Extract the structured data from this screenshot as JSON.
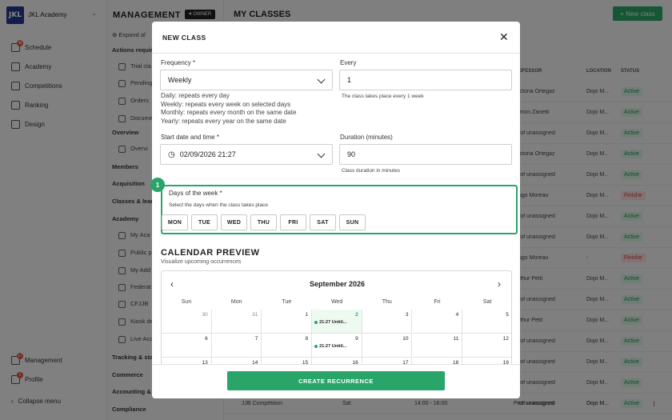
{
  "app": {
    "name": "JKL Academy",
    "logo_text": "JKL"
  },
  "sidebar": {
    "items": [
      {
        "label": "Schedule",
        "icon": "calendar-icon",
        "badge": "38"
      },
      {
        "label": "Academy",
        "icon": "academy-icon"
      },
      {
        "label": "Competitions",
        "icon": "trophy-icon"
      },
      {
        "label": "Ranking",
        "icon": "ranking-icon"
      },
      {
        "label": "Design",
        "icon": "design-icon"
      }
    ],
    "bottom": [
      {
        "label": "Management",
        "icon": "management-icon",
        "badge": "17"
      },
      {
        "label": "Profile",
        "icon": "profile-icon",
        "badge": "1"
      }
    ],
    "collapse": "Collapse menu"
  },
  "subnav": {
    "expand": "Expand al",
    "items": [
      "Actions requir",
      "Trial cla",
      "Pending",
      "Orders",
      "Docume",
      "Overview",
      "Overvi",
      "Members",
      "Acquisition",
      "Classes & lean",
      "Academy",
      "My Aca",
      "Public p",
      "My Add",
      "Federat",
      "CFJJB",
      "Kiosk de",
      "Live Acc",
      "Tracking & sta",
      "Commerce",
      "Accounting &",
      "Compliance"
    ]
  },
  "header": {
    "section": "MANAGEMENT",
    "owner_badge": "OWNER",
    "page_title": "MY CLASSES",
    "new_class": "+ New class"
  },
  "table": {
    "headers": [
      "OFESSOR",
      "LOCATION",
      "STATUS"
    ],
    "rows": [
      {
        "professor": "ictoria Ortegaz",
        "location": "Dojo M...",
        "status": "Active"
      },
      {
        "professor": "imon Zanetti",
        "location": "Dojo M...",
        "status": "Active"
      },
      {
        "professor": "rof unassigned",
        "location": "Dojo M...",
        "status": "Active"
      },
      {
        "professor": "ictoria Ortegaz",
        "location": "Dojo M...",
        "status": "Active"
      },
      {
        "professor": "rof unassigned",
        "location": "Dojo M...",
        "status": "Active"
      },
      {
        "professor": "ugo Moreau",
        "location": "Dojo M...",
        "status": "Finishe"
      },
      {
        "professor": "rof unassigned",
        "location": "Dojo M...",
        "status": "Active"
      },
      {
        "professor": "rof unassigned",
        "location": "Dojo M...",
        "status": "Active"
      },
      {
        "professor": "ugo Moreau",
        "location": "-",
        "status": "Finishe"
      },
      {
        "professor": "rthur Petit",
        "location": "Dojo M...",
        "status": "Active"
      },
      {
        "professor": "rof unassigned",
        "location": "Dojo M...",
        "status": "Active"
      },
      {
        "professor": "rthur Petit",
        "location": "Dojo M...",
        "status": "Active"
      },
      {
        "professor": "rof unassigned",
        "location": "Dojo M...",
        "status": "Active"
      },
      {
        "professor": "rof unassigned",
        "location": "Dojo M...",
        "status": "Active"
      },
      {
        "professor": "rof unassigned",
        "location": "Dojo M...",
        "status": "Active"
      },
      {
        "professor": "rof unassigned",
        "location": "Dojo M...",
        "status": "Active"
      }
    ],
    "last_row": {
      "name": "JJB Compétition",
      "day": "Sat",
      "time": "14:00 - 16:00",
      "professor": "Prof unassigned",
      "location": "Dojo M...",
      "status": "Active"
    }
  },
  "modal": {
    "title": "NEW CLASS",
    "frequency": {
      "label": "Frequency *",
      "value": "Weekly"
    },
    "every": {
      "label": "Every",
      "value": "1",
      "help": "The class takes place every 1 week"
    },
    "frequency_help": [
      "Daily: repeats every day",
      "Weekly: repeats every week on selected days",
      "Monthly: repeats every month on the same date",
      "Yearly: repeats every year on the same date"
    ],
    "start": {
      "label": "Start date and time *",
      "value": "02/09/2026 21:27"
    },
    "duration": {
      "label": "Duration (minutes)",
      "value": "90",
      "help": "Class duration in minutes"
    },
    "days": {
      "step": "1",
      "label": "Days of the week *",
      "help": "Select the days when the class takes place",
      "options": [
        "MON",
        "TUE",
        "WED",
        "THU",
        "FRI",
        "SAT",
        "SUN"
      ]
    },
    "preview": {
      "title": "CALENDAR PREVIEW",
      "subtitle": "Visualize upcoming occurrences",
      "month": "September 2026",
      "weekdays": [
        "Sun",
        "Mon",
        "Tue",
        "Wed",
        "Thu",
        "Fri",
        "Sat"
      ],
      "weeks": [
        [
          "30",
          "31",
          "1",
          "2",
          "3",
          "4",
          "5"
        ],
        [
          "6",
          "7",
          "8",
          "9",
          "10",
          "11",
          "12"
        ],
        [
          "13",
          "14",
          "15",
          "16",
          "17",
          "18",
          "19"
        ]
      ],
      "event": "21:27 Untitl..."
    },
    "submit": "CREATE RECURRENCE"
  },
  "colors": {
    "accent": "#2aa56a",
    "brand": "#233a8c"
  }
}
